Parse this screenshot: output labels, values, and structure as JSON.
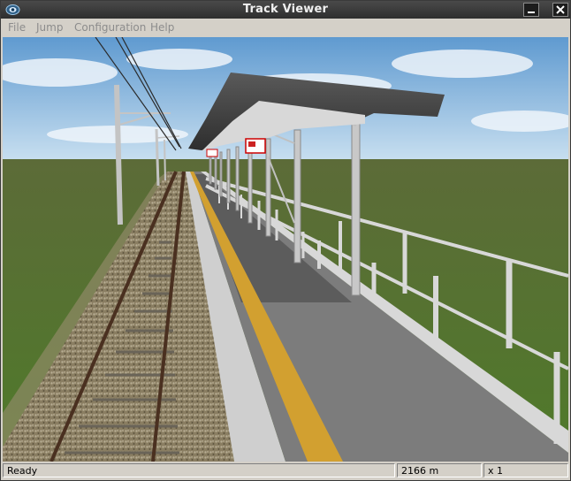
{
  "window": {
    "title": "Track Viewer"
  },
  "menu": {
    "items": [
      {
        "label": "File"
      },
      {
        "label": "Jump"
      },
      {
        "label": "Configuration"
      },
      {
        "label": "Help"
      }
    ]
  },
  "status": {
    "text": "Ready",
    "distance": "2166 m",
    "speed": "x 1"
  },
  "colors": {
    "titlebar": "#2e2e2e",
    "sky": "#8ab6de",
    "grass": "#5a6e32",
    "platform": "#6e6e6e",
    "tactile_strip": "#d2a030"
  }
}
